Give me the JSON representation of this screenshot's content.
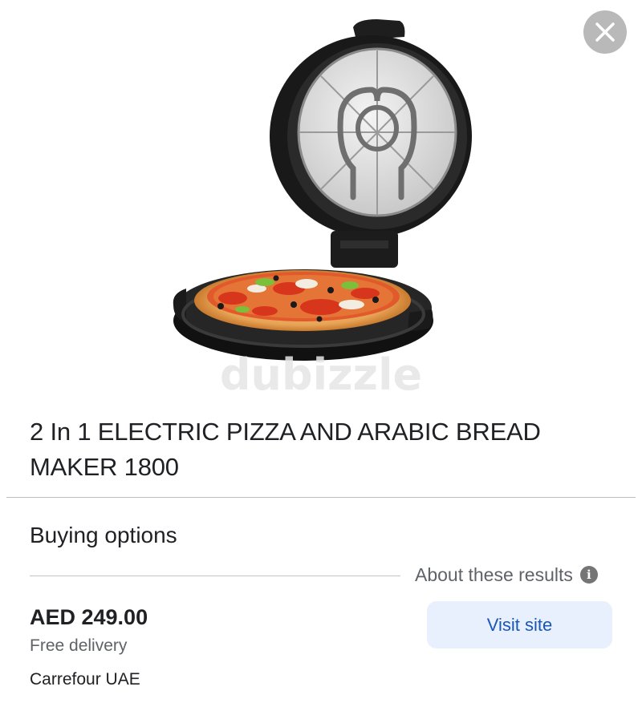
{
  "product": {
    "title": "2 In 1 ELECTRIC PIZZA AND ARABIC BREAD MAKER 1800",
    "image_watermark": "dubizzle"
  },
  "buying_options": {
    "heading": "Buying options",
    "about_label": "About these results",
    "offer": {
      "price": "AED 249.00",
      "delivery": "Free delivery",
      "merchant": "Carrefour UAE",
      "visit_label": "Visit site"
    }
  },
  "icons": {
    "close": "close-icon",
    "info": "info-icon"
  },
  "colors": {
    "visit_button_bg": "#e8f0fe",
    "visit_button_text": "#1a56b8",
    "close_button_bg": "#b9b9b9"
  }
}
